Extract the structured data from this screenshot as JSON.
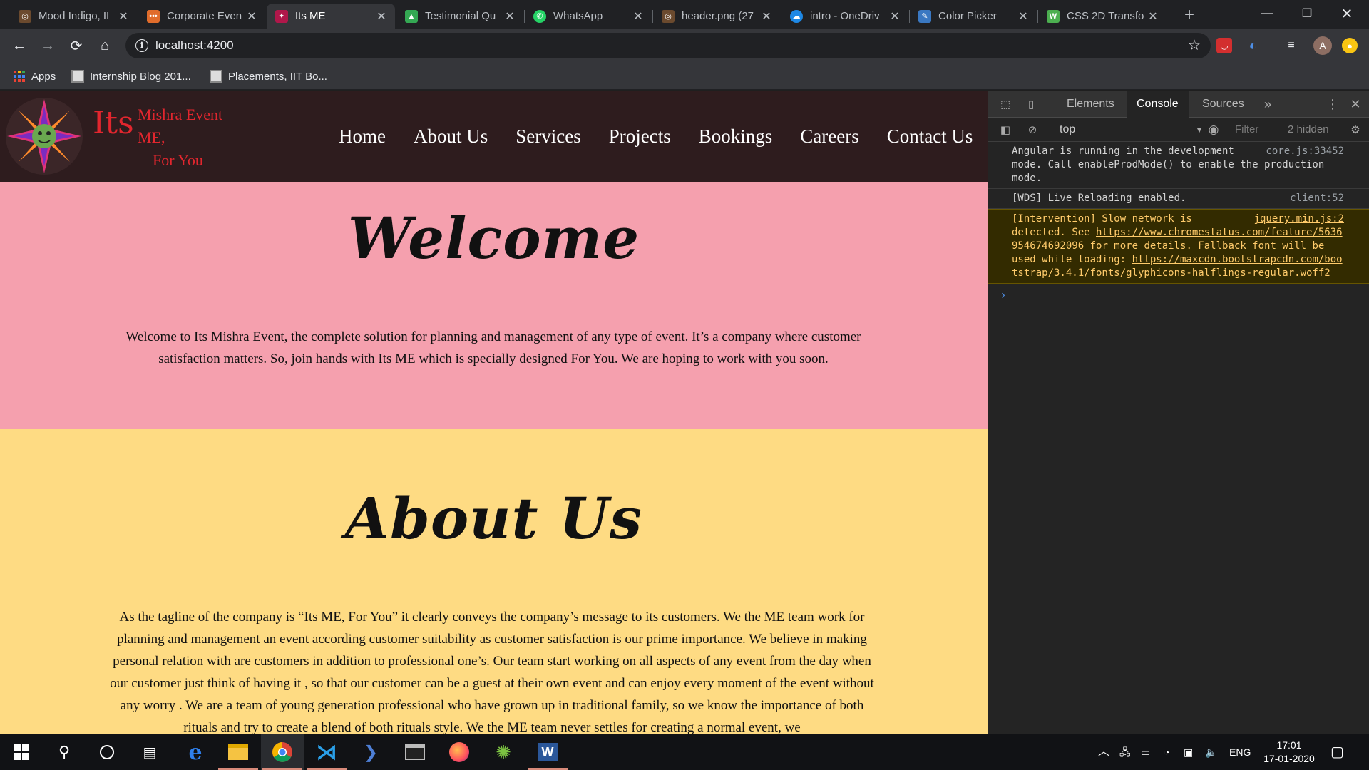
{
  "browser": {
    "tabs": [
      {
        "title": "Mood Indigo, II",
        "favicon_color": "#6b4a2e",
        "active": false
      },
      {
        "title": "Corporate Even",
        "favicon_color": "#e06c2b",
        "active": false
      },
      {
        "title": "Its ME",
        "favicon_color": "#b0174a",
        "active": true
      },
      {
        "title": "Testimonial Qu",
        "favicon_color": "#34a853",
        "active": false
      },
      {
        "title": "WhatsApp",
        "favicon_color": "#25d366",
        "active": false
      },
      {
        "title": "header.png (27",
        "favicon_color": "#6b4a2e",
        "active": false
      },
      {
        "title": "intro - OneDriv",
        "favicon_color": "#1e88e5",
        "active": false
      },
      {
        "title": "Color Picker",
        "favicon_color": "#3a78c2",
        "active": false
      },
      {
        "title": "CSS 2D Transfo",
        "favicon_color": "#4caf50",
        "active": false
      }
    ],
    "url": "localhost:4200",
    "profile_initial": "A",
    "bookmarks": [
      {
        "label": "Apps"
      },
      {
        "label": "Internship Blog 201..."
      },
      {
        "label": "Placements, IIT Bo..."
      }
    ]
  },
  "site": {
    "brand": {
      "its": "Its",
      "line1": "Mishra Event",
      "line2": "ME,",
      "line3": "For You"
    },
    "nav": [
      "Home",
      "About Us",
      "Services",
      "Projects",
      "Bookings",
      "Careers",
      "Contact Us"
    ],
    "welcome": {
      "title": "Welcome",
      "text": "Welcome to Its Mishra Event, the complete solution for planning and management of any type of event. It’s a company where customer satisfaction matters. So, join hands with Its ME which is specially designed For You. We are hoping to work with you soon."
    },
    "about": {
      "title": "About Us",
      "text": "As the tagline of the company is “Its ME, For You” it clearly conveys the company’s message to its customers. We the ME team work for planning and management an event according customer suitability as customer satisfaction is our prime importance. We believe in making personal relation with are customers in addition to professional one’s. Our team start working on all aspects of any event from the day when our customer just think of having it , so that our customer can be a guest at their own event and can enjoy every moment of the event without any worry . We are a team of young generation professional who have grown up in traditional family, so we know the importance of both rituals and try to create a blend of both rituals style. We the ME team never settles for creating a normal event, we"
    }
  },
  "devtools": {
    "tabs": [
      "Elements",
      "Console",
      "Sources"
    ],
    "active_tab": "Console",
    "context": "top",
    "filter_placeholder": "Filter",
    "hidden_count": "2 hidden",
    "messages": [
      {
        "type": "log",
        "text": "Angular is running in the development mode. Call enableProdMode() to enable the production mode.",
        "source": "core.js:33452"
      },
      {
        "type": "log",
        "text": "[WDS] Live Reloading enabled.",
        "source": "client:52"
      },
      {
        "type": "warn",
        "text_before": "[Intervention] Slow network is detected. See ",
        "link1": "https://www.chromestatus.com/feature/5636954674692096",
        "text_mid": " for more details. Fallback font will be used while loading: ",
        "link2": "https://maxcdn.bootstrapcdn.com/bootstrap/3.4.1/fonts/glyphicons-halflings-regular.woff2",
        "source": "jquery.min.js:2"
      }
    ]
  },
  "taskbar": {
    "language": "ENG",
    "time": "17:01",
    "date": "17-01-2020"
  }
}
